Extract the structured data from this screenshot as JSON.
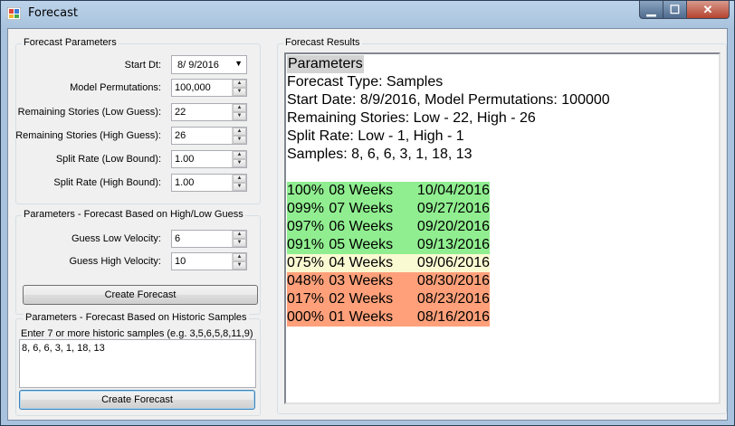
{
  "window": {
    "title": "Forecast",
    "caption": {
      "minimize": "▁",
      "maximize": "☐",
      "close": "✕"
    }
  },
  "params": {
    "title": "Forecast Parameters",
    "start_dt": {
      "label": "Start Dt:",
      "value": "8/  9/2016"
    },
    "fields": [
      {
        "label": "Model Permutations:",
        "value": "100,000"
      },
      {
        "label": "Remaining Stories (Low Guess):",
        "value": "22"
      },
      {
        "label": "Remaining Stories (High Guess):",
        "value": "26"
      },
      {
        "label": "Split Rate (Low Bound):",
        "value": "1.00"
      },
      {
        "label": "Split Rate (High Bound):",
        "value": "1.00"
      }
    ]
  },
  "guess": {
    "title": "Parameters - Forecast Based on High/Low Guess",
    "fields": [
      {
        "label": "Guess Low Velocity:",
        "value": "6"
      },
      {
        "label": "Guess High Velocity:",
        "value": "10"
      }
    ],
    "button": "Create Forecast"
  },
  "historic": {
    "title": "Parameters - Forecast Based on Historic Samples",
    "hint": "Enter 7 or more historic samples (e.g. 3,5,6,5,8,11,9)",
    "value": "8, 6, 6, 3, 1, 18, 13",
    "button": "Create Forecast"
  },
  "results": {
    "title": "Forecast Results",
    "heading": "Parameters",
    "lines": [
      "Forecast Type: Samples",
      "Start Date: 8/9/2016, Model Permutations: 100000",
      "Remaining Stories: Low - 22, High - 26",
      "Split Rate: Low - 1, High - 1",
      "Samples: 8, 6, 6, 3, 1, 18, 13"
    ],
    "forecast": [
      {
        "pct": "100%",
        "weeks": "08 Weeks",
        "date": "10/04/2016",
        "color": "#90ee90"
      },
      {
        "pct": "099%",
        "weeks": "07 Weeks",
        "date": "09/27/2016",
        "color": "#90ee90"
      },
      {
        "pct": "097%",
        "weeks": "06 Weeks",
        "date": "09/20/2016",
        "color": "#90ee90"
      },
      {
        "pct": "091%",
        "weeks": "05 Weeks",
        "date": "09/13/2016",
        "color": "#90ee90"
      },
      {
        "pct": "075%",
        "weeks": "04 Weeks",
        "date": "09/06/2016",
        "color": "#fafad2"
      },
      {
        "pct": "048%",
        "weeks": "03 Weeks",
        "date": "08/30/2016",
        "color": "#ffa07a"
      },
      {
        "pct": "017%",
        "weeks": "02 Weeks",
        "date": "08/23/2016",
        "color": "#ffa07a"
      },
      {
        "pct": "000%",
        "weeks": "01 Weeks",
        "date": "08/16/2016",
        "color": "#ffa07a"
      }
    ]
  }
}
